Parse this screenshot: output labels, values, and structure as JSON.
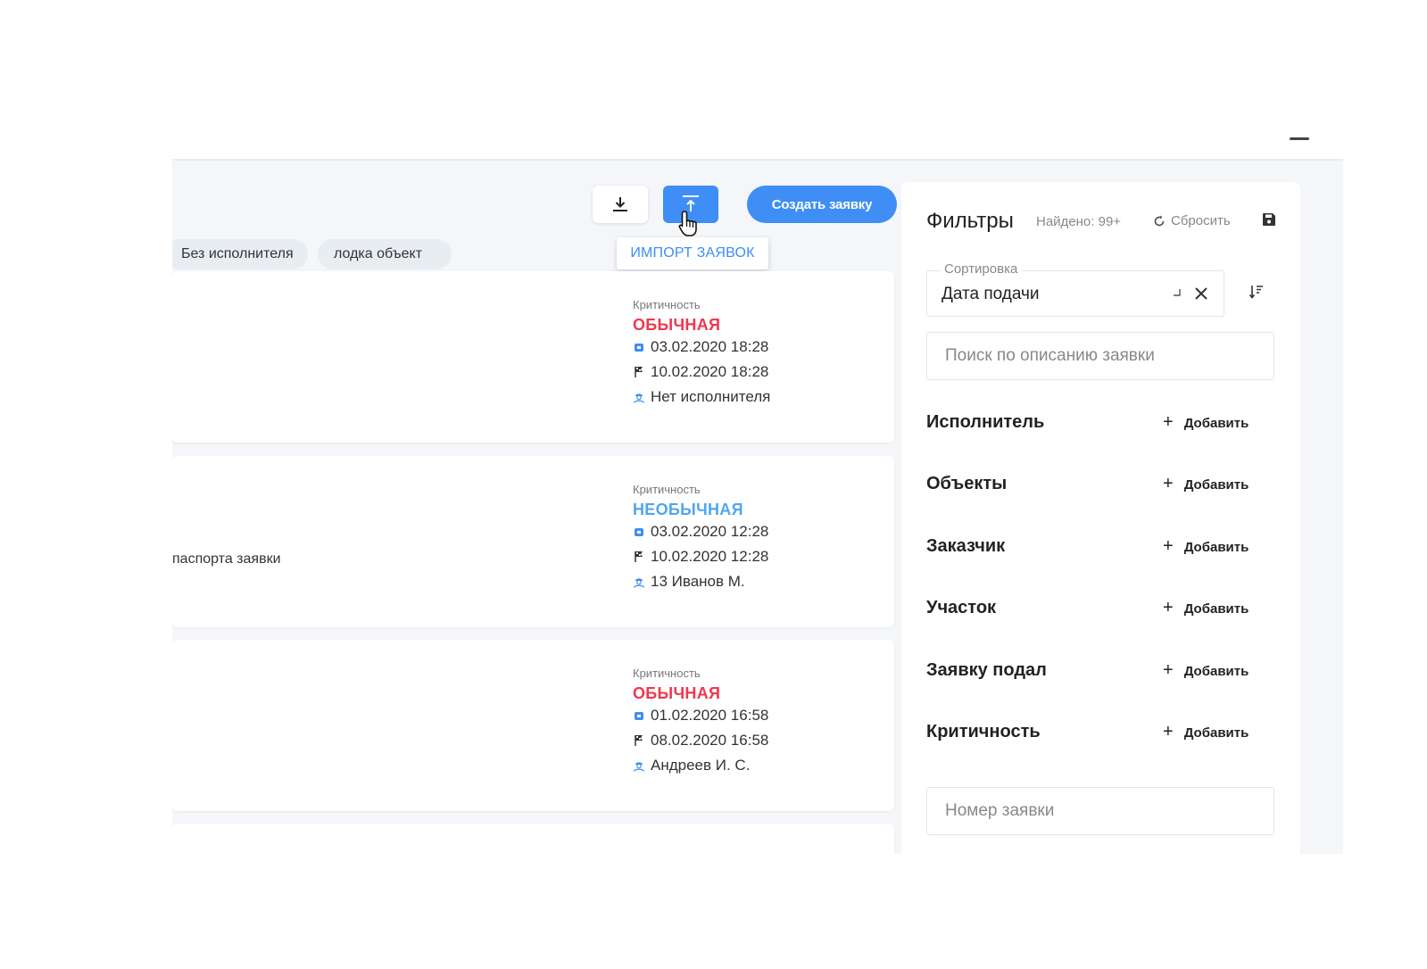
{
  "toolbar": {
    "create_label": "Создать заявку",
    "import_tooltip": "ИМПОРТ ЗАЯВОК"
  },
  "chips": [
    {
      "label": "Без исполнителя"
    },
    {
      "label": "лодка объект"
    }
  ],
  "cards": [
    {
      "criticality_label": "Критичность",
      "criticality": "ОБЫЧНАЯ",
      "criticality_color": "#f0384f",
      "text": "",
      "created": "03.02.2020 18:28",
      "deadline": "10.02.2020 18:28",
      "assignee": "Нет исполнителя"
    },
    {
      "criticality_label": "Критичность",
      "criticality": "НЕОБЫЧНАЯ",
      "criticality_color": "#52a6ee",
      "text": "паспорта заявки",
      "created": "03.02.2020 12:28",
      "deadline": "10.02.2020 12:28",
      "assignee": "13 Иванов М."
    },
    {
      "criticality_label": "Критичность",
      "criticality": "ОБЫЧНАЯ",
      "criticality_color": "#f0384f",
      "text": "",
      "created": "01.02.2020 16:58",
      "deadline": "08.02.2020 16:58",
      "assignee": "Андреев И. С."
    }
  ],
  "filters": {
    "title": "Фильтры",
    "found": "Найдено: 99+",
    "reset_label": "Сбросить",
    "sort_legend": "Сортировка",
    "sort_value": "Дата подачи",
    "search_placeholder": "Поиск по описанию заявки",
    "number_placeholder": "Номер заявки",
    "add_label": "Добавить",
    "rows": [
      {
        "label": "Исполнитель"
      },
      {
        "label": "Объекты"
      },
      {
        "label": "Заказчик"
      },
      {
        "label": "Участок"
      },
      {
        "label": "Заявку подал"
      },
      {
        "label": "Критичность"
      }
    ]
  },
  "colors": {
    "accent": "#3e8ef5",
    "critical": "#f0384f",
    "uncommon": "#52a6ee"
  }
}
